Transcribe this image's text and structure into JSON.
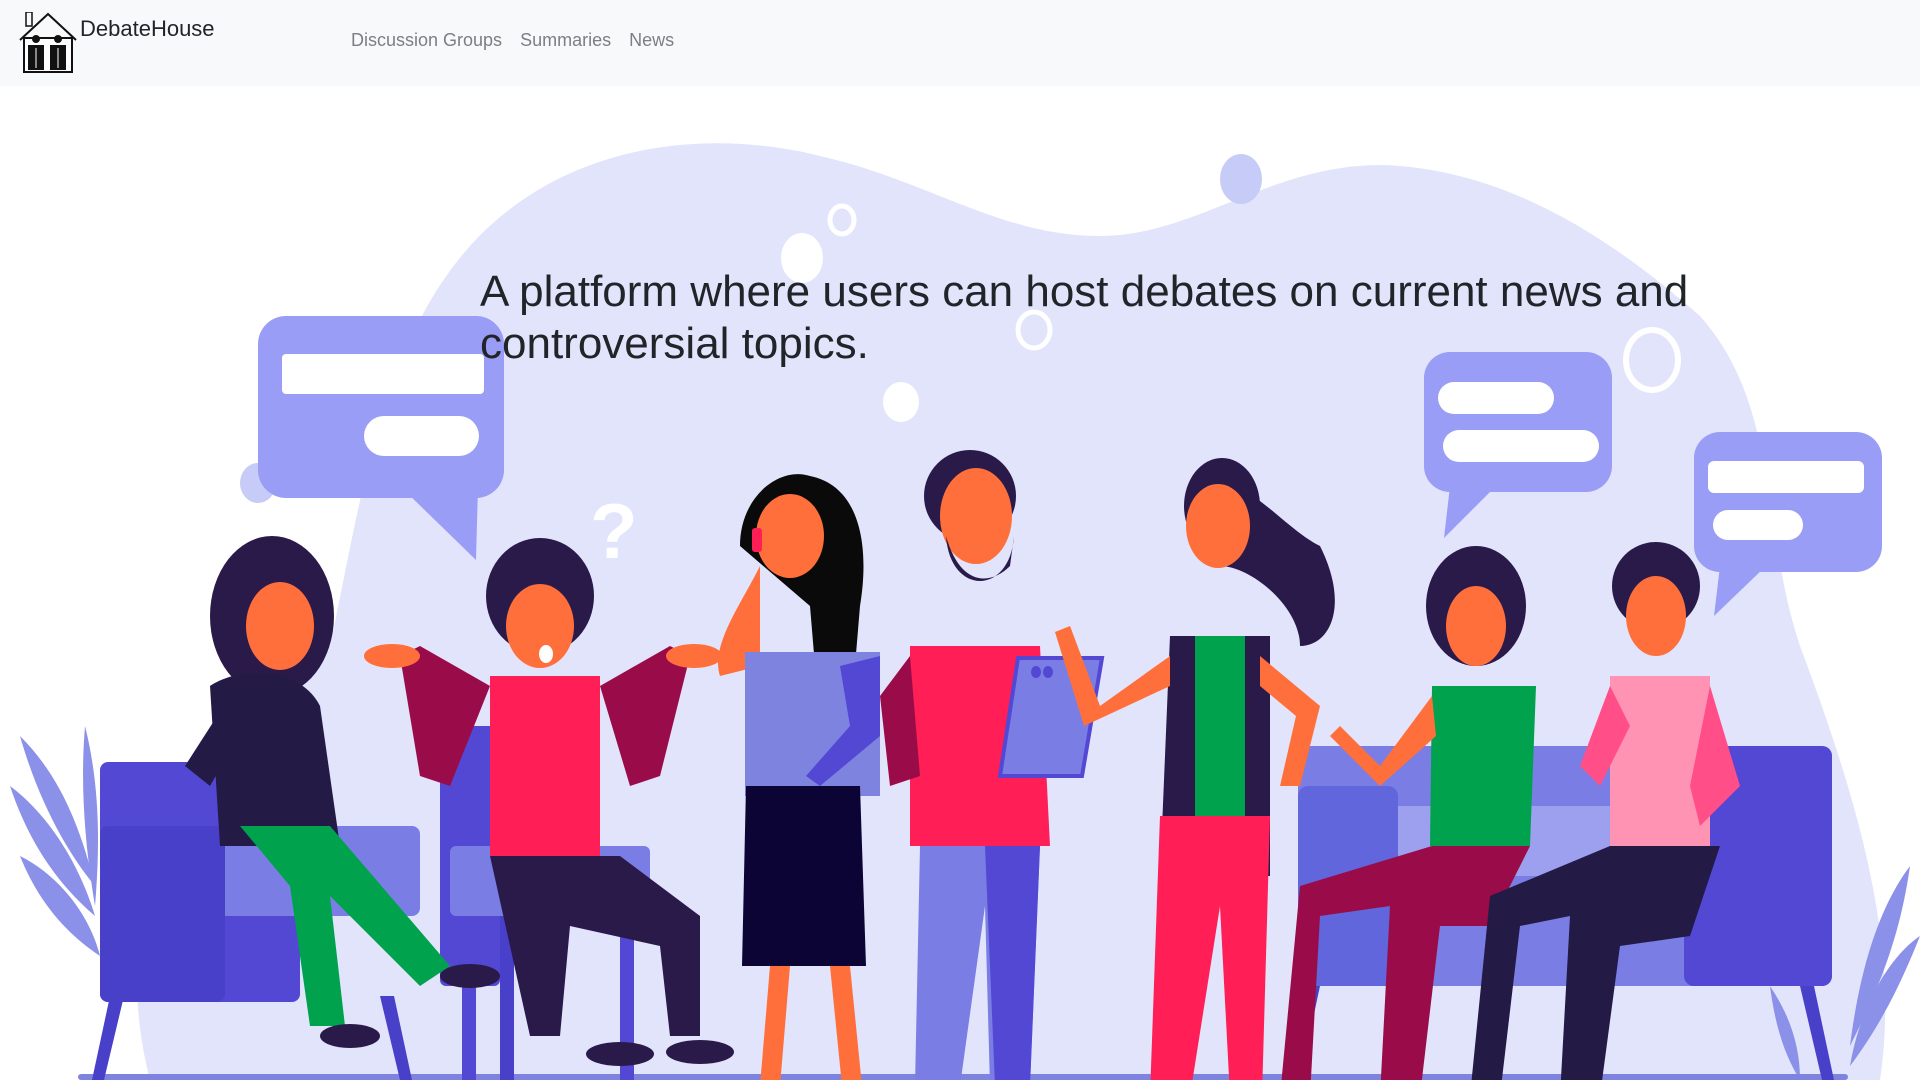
{
  "navbar": {
    "brand_name": "DebateHouse",
    "logo_icon": "house-with-debaters-icon",
    "links": [
      {
        "label": "Discussion Groups"
      },
      {
        "label": "Summaries"
      },
      {
        "label": "News"
      }
    ]
  },
  "hero": {
    "tagline": "A platform where users can host debates on current news and controversial topics.",
    "illustration": "group-of-people-discussing-illustration"
  },
  "colors": {
    "navbar_bg": "#f8f9fa",
    "blob": "#e2e4fb",
    "bubble": "#999df5",
    "link": "#7b7f83"
  }
}
